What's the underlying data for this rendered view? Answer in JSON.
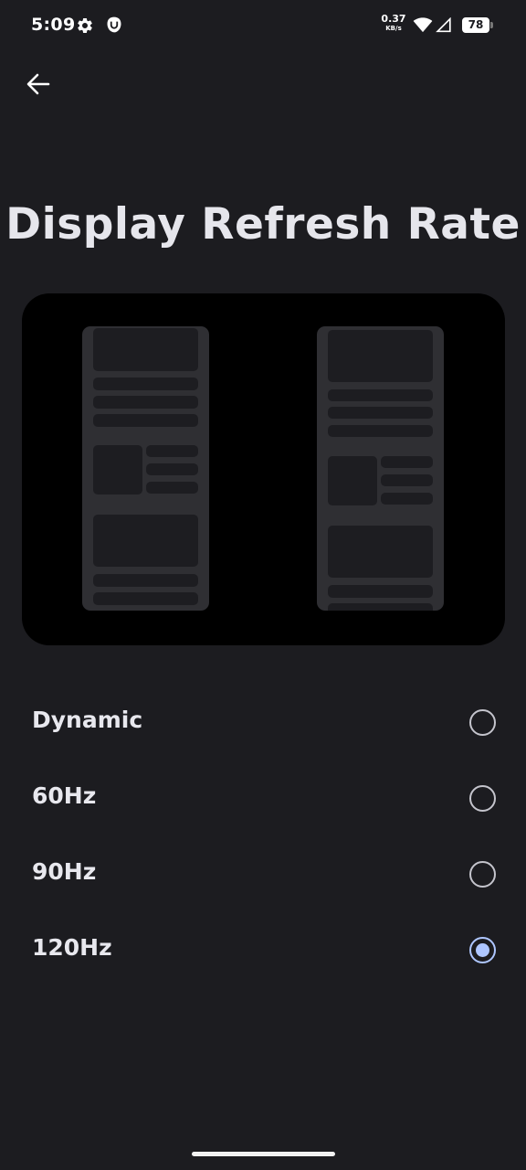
{
  "status_bar": {
    "time": "5:09",
    "net_speed_value": "0.37",
    "net_speed_unit": "KB/s",
    "battery": "78",
    "icons": [
      "gear-icon",
      "app-notification-icon",
      "wifi-icon",
      "cell-signal-icon",
      "battery-icon"
    ]
  },
  "header": {
    "back_icon": "arrow-left-icon",
    "title": "Display Refresh Rate"
  },
  "options": [
    {
      "label": "Dynamic",
      "selected": false
    },
    {
      "label": "60Hz",
      "selected": false
    },
    {
      "label": "90Hz",
      "selected": false
    },
    {
      "label": "120Hz",
      "selected": true
    }
  ],
  "colors": {
    "background": "#1c1c20",
    "accent": "#aec6ff",
    "preview_bg": "#000000"
  }
}
